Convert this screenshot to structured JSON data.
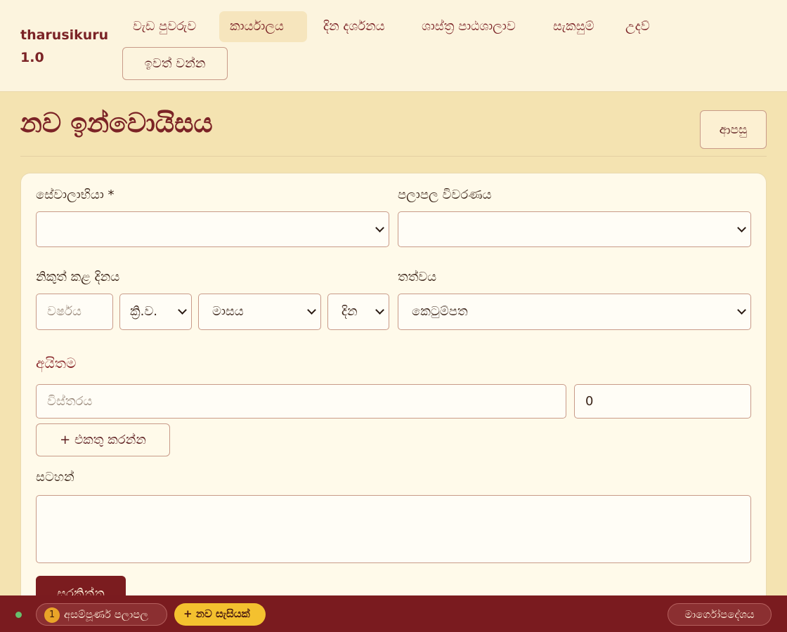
{
  "app": {
    "title": "tharusikuru 1.0"
  },
  "nav": {
    "items": [
      {
        "label": "වැඩ පුවරුව"
      },
      {
        "label": "කාර්යාලය"
      },
      {
        "label": "දින දර්ශනය"
      },
      {
        "label": "ශාස්ත්‍ර පාඨශාලාව"
      },
      {
        "label": "සැකසුම්"
      },
      {
        "label": "උදව්"
      }
    ],
    "active": "කාර්යාලය",
    "logout_label": "ඉවත් වන්න"
  },
  "page": {
    "title": "නව ඉන්වොයිසය",
    "back_label": "ආපසු"
  },
  "form": {
    "client": {
      "label": "සේවාලාභියා *",
      "value": ""
    },
    "results": {
      "label": "පලාපල විවරණය",
      "value": ""
    },
    "issue_date": {
      "label": "නිකුත් කළ දිනය",
      "year_placeholder": "වර්ෂය",
      "era": "ක්‍රි.ව.",
      "month": "මාසය",
      "day": "දින"
    },
    "status": {
      "label": "තත්වය",
      "value": "කෙටුම්පත"
    },
    "items": {
      "title": "අයිතම",
      "description_placeholder": "විස්තරය",
      "amount": "0",
      "add_label": "+ එකතු කරන්න"
    },
    "notes": {
      "label": "සටහන්",
      "value": ""
    },
    "save_label": "සුරකින්න"
  },
  "footer": {
    "status_color": "#67c06d",
    "drafts_count": "1",
    "drafts_label": "අසම්පූර්ණ පලාපල",
    "new_session_label": "+ නව සැසියක්",
    "guide_label": "මාර්ගෝපදේශය"
  },
  "colors": {
    "brand": "#7b2326",
    "background": "#f4e3b1",
    "accent_yellow": "#f4c12f"
  }
}
